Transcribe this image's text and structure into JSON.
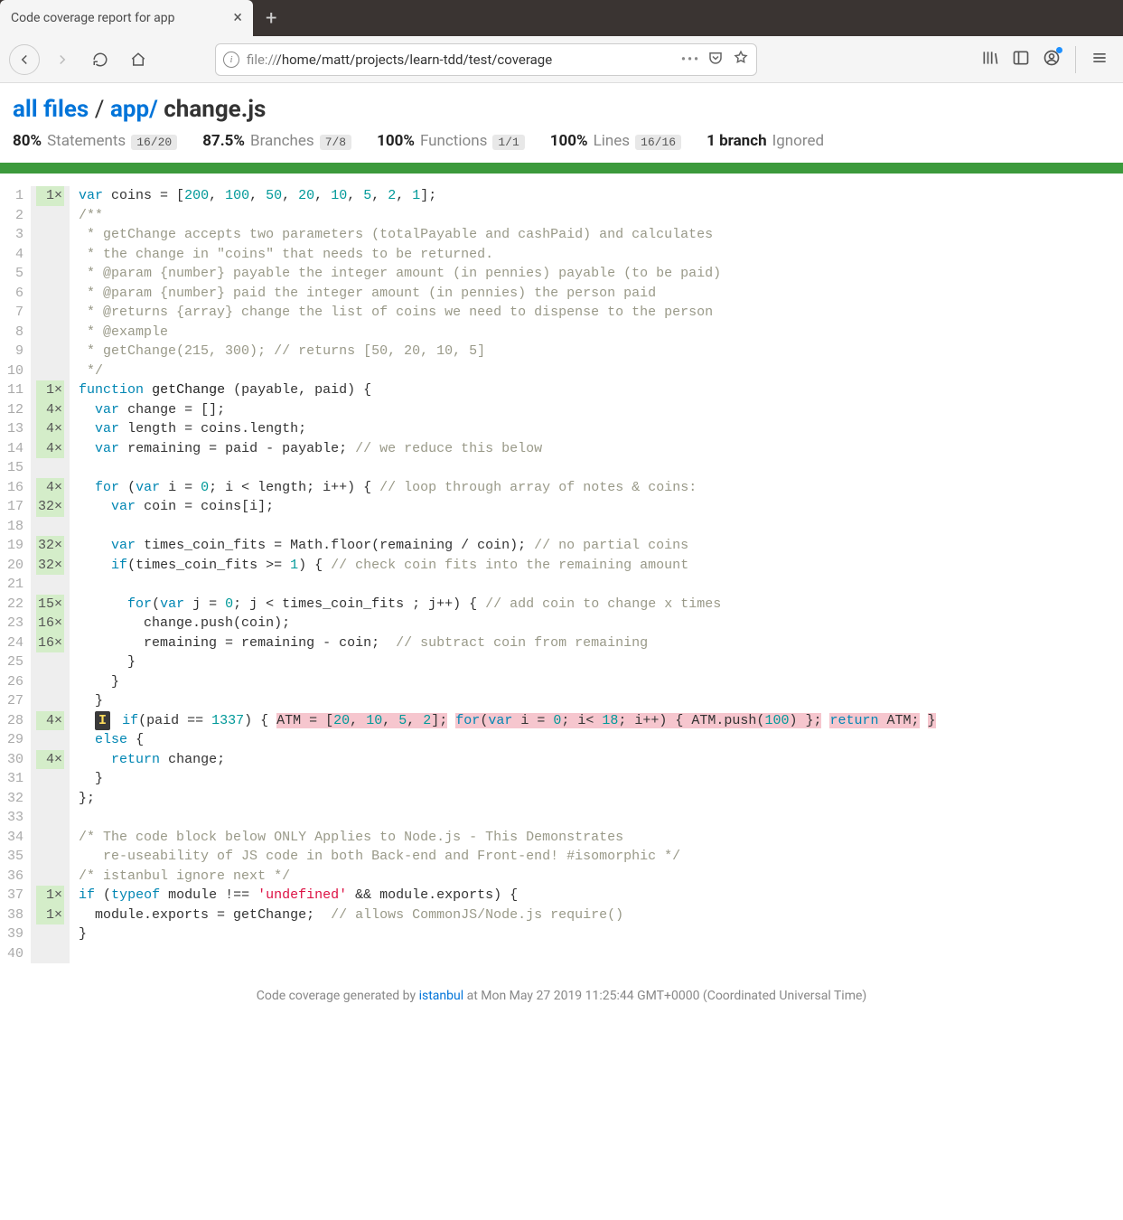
{
  "browser": {
    "tab_title": "Code coverage report for app",
    "url_prefix": "file://",
    "url_path": "/home/matt/projects/learn-tdd/test/coverage",
    "ellipsis": "…"
  },
  "breadcrumb": {
    "root": "all files",
    "sep": " / ",
    "folder": "app/",
    "file": "change.js"
  },
  "stats": {
    "statements": {
      "pct": "80%",
      "label": "Statements",
      "frac": "16/20"
    },
    "branches": {
      "pct": "87.5%",
      "label": "Branches",
      "frac": "7/8"
    },
    "functions": {
      "pct": "100%",
      "label": "Functions",
      "frac": "1/1"
    },
    "lines": {
      "pct": "100%",
      "label": "Lines",
      "frac": "16/16"
    },
    "ignored": {
      "count": "1 branch",
      "label": "Ignored"
    }
  },
  "code": {
    "lines": [
      {
        "n": 1,
        "hits": "1×",
        "hit": true,
        "html": "<span class='kw'>var</span> coins = [<span class='num'>200</span>, <span class='num'>100</span>, <span class='num'>50</span>, <span class='num'>20</span>, <span class='num'>10</span>, <span class='num'>5</span>, <span class='num'>2</span>, <span class='num'>1</span>];"
      },
      {
        "n": 2,
        "hits": "",
        "hit": false,
        "html": "<span class='com'>/**</span>"
      },
      {
        "n": 3,
        "hits": "",
        "hit": false,
        "html": "<span class='com'> * getChange accepts two parameters (totalPayable and cashPaid) and calculates</span>"
      },
      {
        "n": 4,
        "hits": "",
        "hit": false,
        "html": "<span class='com'> * the change in \"coins\" that needs to be returned.</span>"
      },
      {
        "n": 5,
        "hits": "",
        "hit": false,
        "html": "<span class='com'> * @param {number} payable the integer amount (in pennies) payable (to be paid)</span>"
      },
      {
        "n": 6,
        "hits": "",
        "hit": false,
        "html": "<span class='com'> * @param {number} paid the integer amount (in pennies) the person paid</span>"
      },
      {
        "n": 7,
        "hits": "",
        "hit": false,
        "html": "<span class='com'> * @returns {array} change the list of coins we need to dispense to the person</span>"
      },
      {
        "n": 8,
        "hits": "",
        "hit": false,
        "html": "<span class='com'> * @example</span>"
      },
      {
        "n": 9,
        "hits": "",
        "hit": false,
        "html": "<span class='com'> * getChange(215, 300); // returns [50, 20, 10, 5]</span>"
      },
      {
        "n": 10,
        "hits": "",
        "hit": false,
        "html": "<span class='com'> */</span>"
      },
      {
        "n": 11,
        "hits": "1×",
        "hit": true,
        "html": "<span class='kw'>function</span> <span class='fn'>getChange</span> (payable, paid) {"
      },
      {
        "n": 12,
        "hits": "4×",
        "hit": true,
        "html": "  <span class='kw'>var</span> change = [];"
      },
      {
        "n": 13,
        "hits": "4×",
        "hit": true,
        "html": "  <span class='kw'>var</span> length = coins.length;"
      },
      {
        "n": 14,
        "hits": "4×",
        "hit": true,
        "html": "  <span class='kw'>var</span> remaining = paid - payable; <span class='com'>// we reduce this below</span>"
      },
      {
        "n": 15,
        "hits": "",
        "hit": false,
        "html": "&nbsp;"
      },
      {
        "n": 16,
        "hits": "4×",
        "hit": true,
        "html": "  <span class='kw'>for</span> (<span class='kw'>var</span> i = <span class='num'>0</span>; i &lt; length; i++) { <span class='com'>// loop through array of notes &amp; coins:</span>"
      },
      {
        "n": 17,
        "hits": "32×",
        "hit": true,
        "html": "    <span class='kw'>var</span> coin = coins[i];"
      },
      {
        "n": 18,
        "hits": "",
        "hit": false,
        "html": "&nbsp;"
      },
      {
        "n": 19,
        "hits": "32×",
        "hit": true,
        "html": "    <span class='kw'>var</span> times_coin_fits = Math.floor(remaining / coin); <span class='com'>// no partial coins</span>"
      },
      {
        "n": 20,
        "hits": "32×",
        "hit": true,
        "html": "    <span class='kw'>if</span>(times_coin_fits &gt;= <span class='num'>1</span>) { <span class='com'>// check coin fits into the remaining amount</span>"
      },
      {
        "n": 21,
        "hits": "",
        "hit": false,
        "html": "&nbsp;"
      },
      {
        "n": 22,
        "hits": "15×",
        "hit": true,
        "html": "      <span class='kw'>for</span>(<span class='kw'>var</span> j = <span class='num'>0</span>; j &lt; times_coin_fits ; j++) { <span class='com'>// add coin to change x times</span>"
      },
      {
        "n": 23,
        "hits": "16×",
        "hit": true,
        "html": "        change.push(coin);"
      },
      {
        "n": 24,
        "hits": "16×",
        "hit": true,
        "html": "        remaining = remaining - coin;  <span class='com'>// subtract coin from remaining</span>"
      },
      {
        "n": 25,
        "hits": "",
        "hit": false,
        "html": "      }"
      },
      {
        "n": 26,
        "hits": "",
        "hit": false,
        "html": "    }"
      },
      {
        "n": 27,
        "hits": "",
        "hit": false,
        "html": "  }"
      },
      {
        "n": 28,
        "hits": "4×",
        "hit": true,
        "html": "  <span class='ignore-badge' data-name='ignored-branch-badge'>I</span> <span class='kw'>if</span>(paid == <span class='num'>1337</span>) { <span class='not-covered'>ATM = [<span class='num'>20</span>, <span class='num'>10</span>, <span class='num'>5</span>, <span class='num'>2</span>];</span> <span class='not-covered'><span class='kw'>for</span>(<span class='kw'>var</span> i = <span class='num'>0</span>; i&lt; <span class='num'>18</span>; i++) { ATM.push(<span class='num'>100</span>) };</span> <span class='not-covered'><span class='kw'>return</span> ATM;</span> <span class='not-covered'>}</span>"
      },
      {
        "n": 29,
        "hits": "",
        "hit": false,
        "html": "  <span class='kw'>else</span> {"
      },
      {
        "n": 30,
        "hits": "4×",
        "hit": true,
        "html": "    <span class='kw'>return</span> change;"
      },
      {
        "n": 31,
        "hits": "",
        "hit": false,
        "html": "  }"
      },
      {
        "n": 32,
        "hits": "",
        "hit": false,
        "html": "};"
      },
      {
        "n": 33,
        "hits": "",
        "hit": false,
        "html": "&nbsp;"
      },
      {
        "n": 34,
        "hits": "",
        "hit": false,
        "html": "<span class='com'>/* The code block below ONLY Applies to Node.js - This Demonstrates</span>"
      },
      {
        "n": 35,
        "hits": "",
        "hit": false,
        "html": "<span class='com'>   re-useability of JS code in both Back-end and Front-end! #isomorphic */</span>"
      },
      {
        "n": 36,
        "hits": "",
        "hit": false,
        "html": "<span class='com'>/* istanbul ignore next */</span>"
      },
      {
        "n": 37,
        "hits": "1×",
        "hit": true,
        "html": "<span class='kw'>if</span> (<span class='kw'>typeof</span> module !== <span class='str'>'undefined'</span> &amp;&amp; module.exports) {"
      },
      {
        "n": 38,
        "hits": "1×",
        "hit": true,
        "html": "  module.exports = getChange;  <span class='com'>// allows CommonJS/Node.js require()</span>"
      },
      {
        "n": 39,
        "hits": "",
        "hit": false,
        "html": "}"
      },
      {
        "n": 40,
        "hits": "",
        "hit": false,
        "html": "&nbsp;"
      }
    ]
  },
  "footer": {
    "prefix": "Code coverage generated by ",
    "tool": "istanbul",
    "at": " at Mon May 27 2019 11:25:44 GMT+0000 (Coordinated Universal Time)"
  }
}
